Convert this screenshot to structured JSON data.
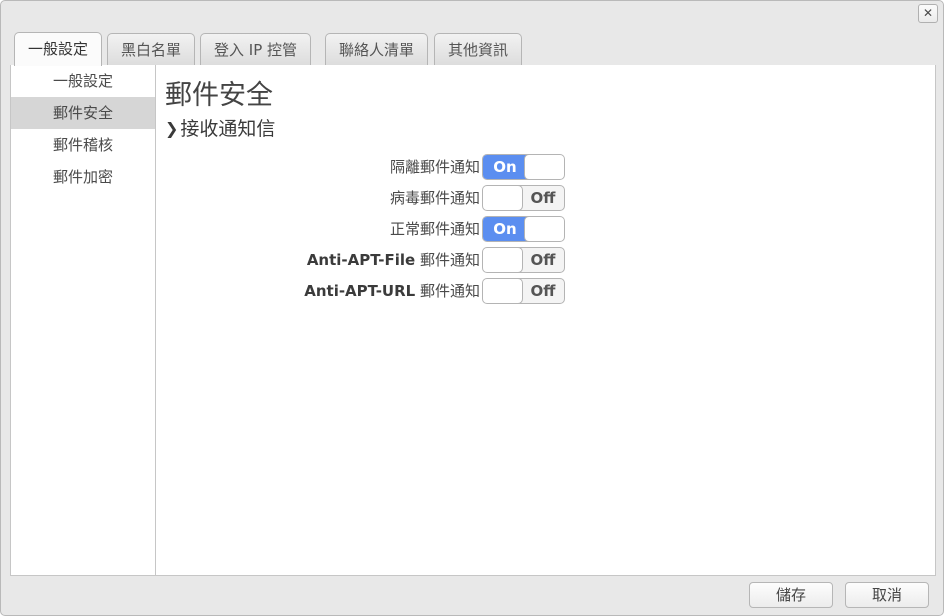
{
  "window": {
    "close_label": "✕"
  },
  "tabs": [
    {
      "label": "一般設定",
      "active": true
    },
    {
      "label": "黑白名單",
      "active": false
    },
    {
      "label": "登入 IP 控管",
      "active": false
    },
    {
      "label": "聯絡人清單",
      "active": false
    },
    {
      "label": "其他資訊",
      "active": false
    }
  ],
  "sidebar": {
    "items": [
      {
        "label": "一般設定",
        "selected": false
      },
      {
        "label": "郵件安全",
        "selected": true
      },
      {
        "label": "郵件稽核",
        "selected": false
      },
      {
        "label": "郵件加密",
        "selected": false
      }
    ]
  },
  "main": {
    "title": "郵件安全",
    "section": {
      "chevron": "❯",
      "label": "接收通知信"
    },
    "rows": [
      {
        "lead": "",
        "label": "隔離郵件通知",
        "state": "On",
        "on": true
      },
      {
        "lead": "",
        "label": "病毒郵件通知",
        "state": "Off",
        "on": false
      },
      {
        "lead": "",
        "label": "正常郵件通知",
        "state": "On",
        "on": true
      },
      {
        "lead": "Anti-APT-File",
        "label": " 郵件通知",
        "state": "Off",
        "on": false
      },
      {
        "lead": "Anti-APT-URL",
        "label": " 郵件通知",
        "state": "Off",
        "on": false
      }
    ]
  },
  "footer": {
    "save_label": "儲存",
    "cancel_label": "取消"
  },
  "colors": {
    "toggle_on": "#5b8ef0",
    "selected_item": "#d6d6d6",
    "window_bg": "#e8e8e8"
  }
}
